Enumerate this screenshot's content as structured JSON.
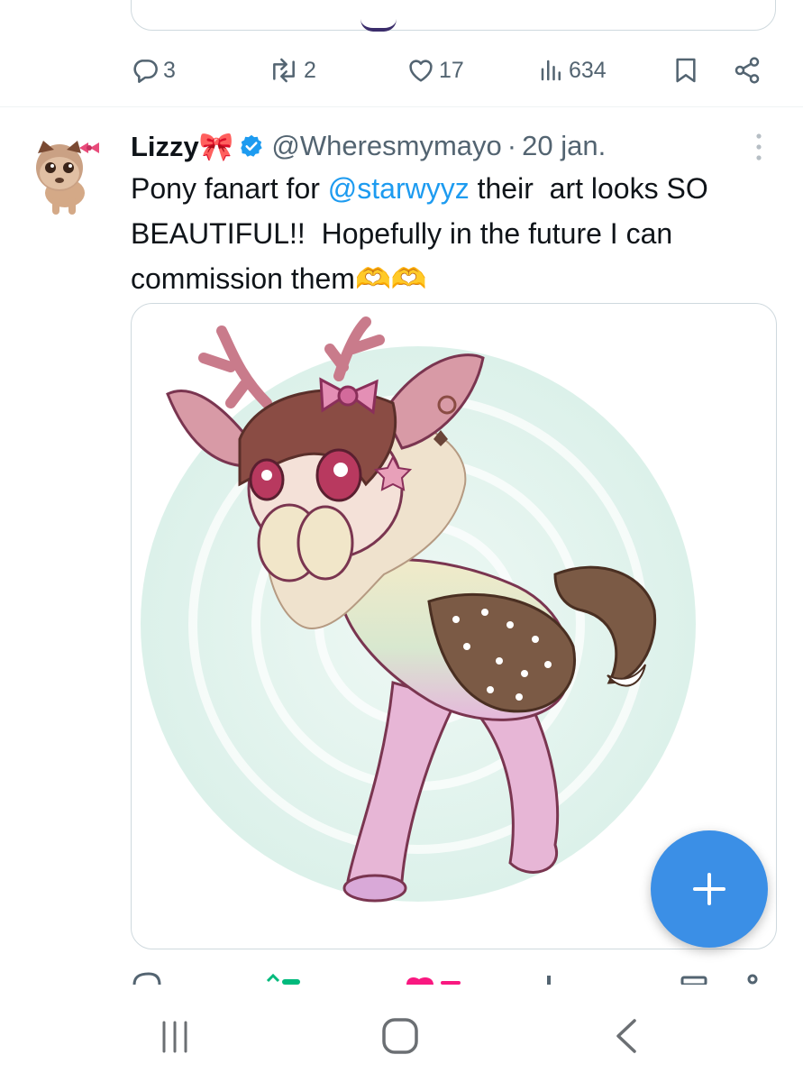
{
  "previous_tweet": {
    "actions": {
      "reply_count": "3",
      "repost_count": "2",
      "like_count": "17",
      "views_count": "634"
    }
  },
  "tweet": {
    "author_name": "Lizzy🎀",
    "handle": "@Wheresmymayo",
    "separator": "·",
    "date": "20 jan.",
    "text_part1": "Pony fanart for ",
    "mention": "@starwyyz",
    "text_part2": " their  art looks SO BEAUTIFUL!!  Hopefully in the future I can commission them🫶🫶"
  },
  "colors": {
    "accent": "#1d9bf0",
    "fab": "#3b8fe6",
    "text_primary": "#0f1419",
    "text_secondary": "#536471",
    "like_active": "#f91880",
    "repost_active": "#00ba7c"
  },
  "icons": {
    "reply": "reply-icon",
    "repost": "repost-icon",
    "like": "heart-icon",
    "views": "views-icon",
    "bookmark": "bookmark-icon",
    "share": "share-icon",
    "more": "more-vertical-icon",
    "compose": "plus-icon",
    "nav_recents": "recents-icon",
    "nav_home": "home-icon",
    "nav_back": "back-icon"
  }
}
